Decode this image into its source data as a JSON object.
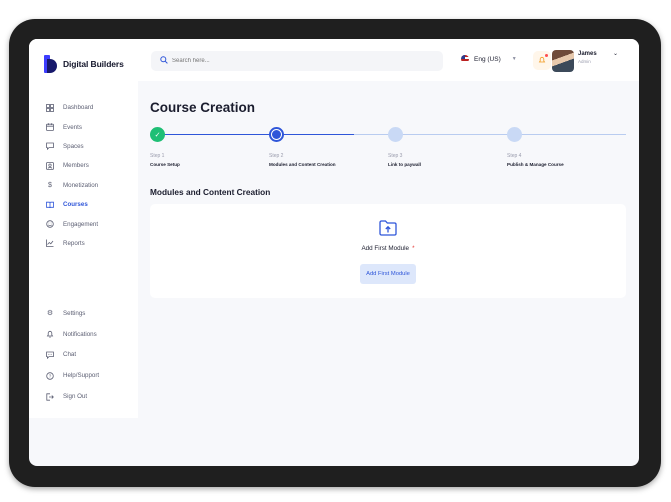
{
  "brand": {
    "name": "Digital Builders"
  },
  "sidebar": {
    "items": [
      {
        "label": "Dashboard",
        "icon": "dashboard-icon"
      },
      {
        "label": "Events",
        "icon": "calendar-icon"
      },
      {
        "label": "Spaces",
        "icon": "chat-bubble-icon"
      },
      {
        "label": "Members",
        "icon": "members-icon"
      },
      {
        "label": "Monetization",
        "icon": "dollar-icon"
      },
      {
        "label": "Courses",
        "icon": "book-icon",
        "active": true
      },
      {
        "label": "Engagement",
        "icon": "engagement-icon"
      },
      {
        "label": "Reports",
        "icon": "chart-icon"
      }
    ],
    "bottom_items": [
      {
        "label": "Settings",
        "icon": "gear-icon"
      },
      {
        "label": "Notifications",
        "icon": "bell-icon"
      },
      {
        "label": "Chat",
        "icon": "chat-icon"
      },
      {
        "label": "Help/Support",
        "icon": "help-icon"
      },
      {
        "label": "Sign Out",
        "icon": "sign-out-icon"
      }
    ]
  },
  "header": {
    "search_placeholder": "Search here...",
    "language": "Eng (US)",
    "user": {
      "name": "James",
      "role": "Admin"
    }
  },
  "page": {
    "title": "Course Creation",
    "steps": [
      {
        "number": "Step 1",
        "label": "Course Setup",
        "state": "done"
      },
      {
        "number": "Step 2",
        "label": "Modules and Content Creation",
        "state": "current"
      },
      {
        "number": "Step 3",
        "label": "Link to paywall",
        "state": "todo"
      },
      {
        "number": "Step 4",
        "label": "Publish & Manage Course",
        "state": "todo"
      }
    ],
    "section_title": "Modules and Content Creation",
    "add_module_label": "Add First Module",
    "required_mark": "*",
    "add_module_button": "Add First Module"
  },
  "colors": {
    "accent": "#2f56d9",
    "success": "#1fbf75",
    "pending": "#c9d9f5",
    "notification": "#f29b22"
  }
}
